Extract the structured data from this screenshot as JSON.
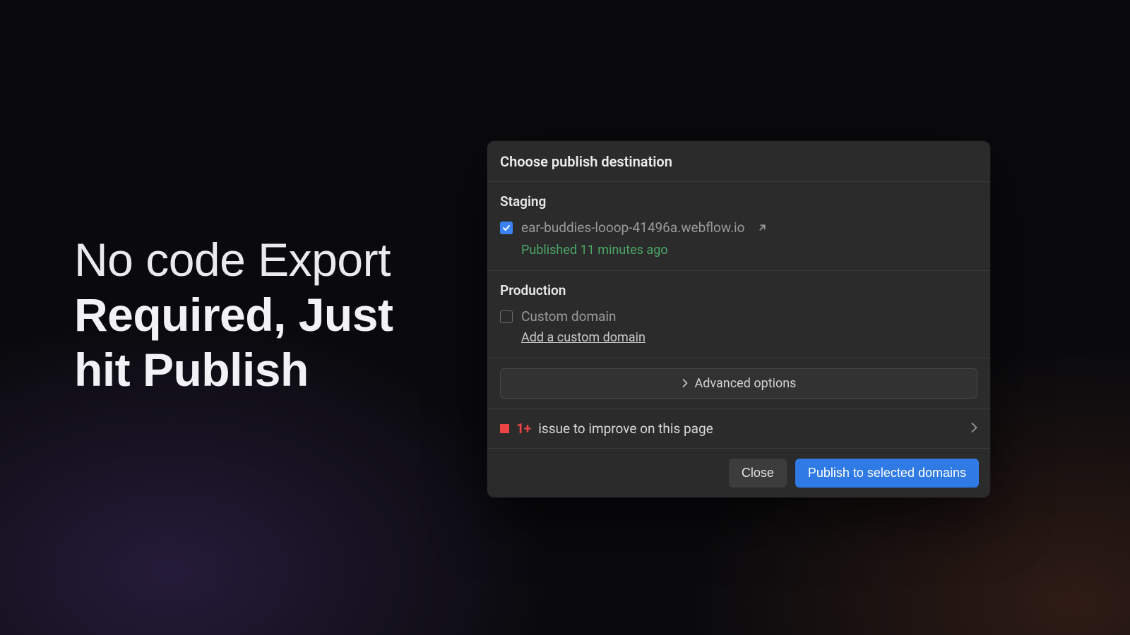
{
  "headline": {
    "line1": "No code Export",
    "line2": "Required, Just",
    "line3": "hit Publish"
  },
  "dialog": {
    "title": "Choose publish destination",
    "staging": {
      "section_title": "Staging",
      "domain": "ear-buddies-looop-41496a.webflow.io",
      "published_status": "Published 11 minutes ago"
    },
    "production": {
      "section_title": "Production",
      "custom_domain_label": "Custom domain",
      "add_custom_domain": "Add a custom domain"
    },
    "advanced_label": "Advanced options",
    "issues": {
      "count_label": "1+",
      "text": "issue to improve on this page"
    },
    "buttons": {
      "close": "Close",
      "publish": "Publish to selected domains"
    }
  },
  "colors": {
    "accent_blue": "#2f7ae5",
    "checkbox_blue": "#3b82f6",
    "success_green": "#4ca767",
    "error_red": "#ef4444"
  }
}
